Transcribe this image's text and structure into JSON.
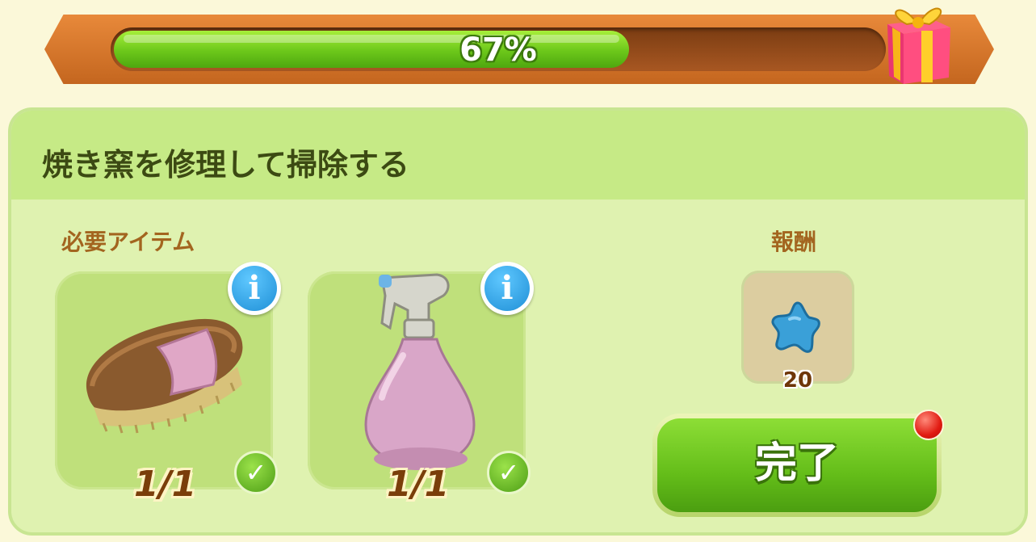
{
  "progress": {
    "percent_text": "67%",
    "fraction": 0.67
  },
  "task": {
    "title": "焼き窯を修理して掃除する"
  },
  "required": {
    "label": "必要アイテム",
    "items": [
      {
        "name": "brush",
        "count": "1/1",
        "info": "i",
        "check": "✓"
      },
      {
        "name": "spray-bottle",
        "count": "1/1",
        "info": "i",
        "check": "✓"
      }
    ]
  },
  "reward": {
    "label": "報酬",
    "icon": "blue-star-icon",
    "amount": "20"
  },
  "complete_button": {
    "label": "完了"
  },
  "colors": {
    "accent_green": "#64bd19",
    "progress_frame": "#d87730",
    "panel": "#dff2b0"
  }
}
